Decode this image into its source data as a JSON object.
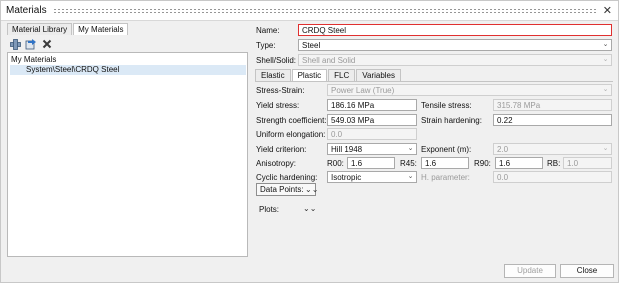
{
  "window": {
    "title": "Materials"
  },
  "left_tabs": [
    {
      "label": "Material Library"
    },
    {
      "label": "My Materials"
    }
  ],
  "toolbar": {
    "add_icon": "add-material-icon",
    "import_icon": "import-icon",
    "delete_icon": "delete-icon"
  },
  "tree": {
    "root": "My Materials",
    "selected": "System\\Steel\\CRDQ Steel"
  },
  "props": {
    "name_label": "Name:",
    "name_value": "CRDQ Steel",
    "type_label": "Type:",
    "type_value": "Steel",
    "shell_label": "Shell/Solid:",
    "shell_value": "Shell and Solid"
  },
  "tabs": [
    {
      "label": "Elastic"
    },
    {
      "label": "Plastic"
    },
    {
      "label": "FLC"
    },
    {
      "label": "Variables"
    }
  ],
  "plastic": {
    "stress_strain_label": "Stress-Strain:",
    "stress_strain_value": "Power Law (True)",
    "yield_stress_label": "Yield stress:",
    "yield_stress_value": "186.16 MPa",
    "tensile_stress_label": "Tensile stress:",
    "tensile_stress_value": "315.78 MPa",
    "strength_coef_label": "Strength coefficient:",
    "strength_coef_value": "549.03 MPa",
    "strain_hardening_label": "Strain hardening:",
    "strain_hardening_value": "0.22",
    "uniform_elong_label": "Uniform elongation:",
    "uniform_elong_value": "0.0",
    "yield_criterion_label": "Yield criterion:",
    "yield_criterion_value": "Hill 1948",
    "exponent_label": "Exponent (m):",
    "exponent_value": "2.0",
    "anisotropy_label": "Anisotropy:",
    "r00_label": "R00:",
    "r00_value": "1.6",
    "r45_label": "R45:",
    "r45_value": "1.6",
    "r90_label": "R90:",
    "r90_value": "1.6",
    "rb_label": "RB:",
    "rb_value": "1.0",
    "cyclic_label": "Cyclic hardening:",
    "cyclic_value": "Isotropic",
    "hparam_label": "H. parameter:",
    "hparam_value": "0.0",
    "data_points_label": "Data Points:",
    "plots_label": "Plots:"
  },
  "buttons": {
    "update": "Update",
    "close": "Close"
  }
}
